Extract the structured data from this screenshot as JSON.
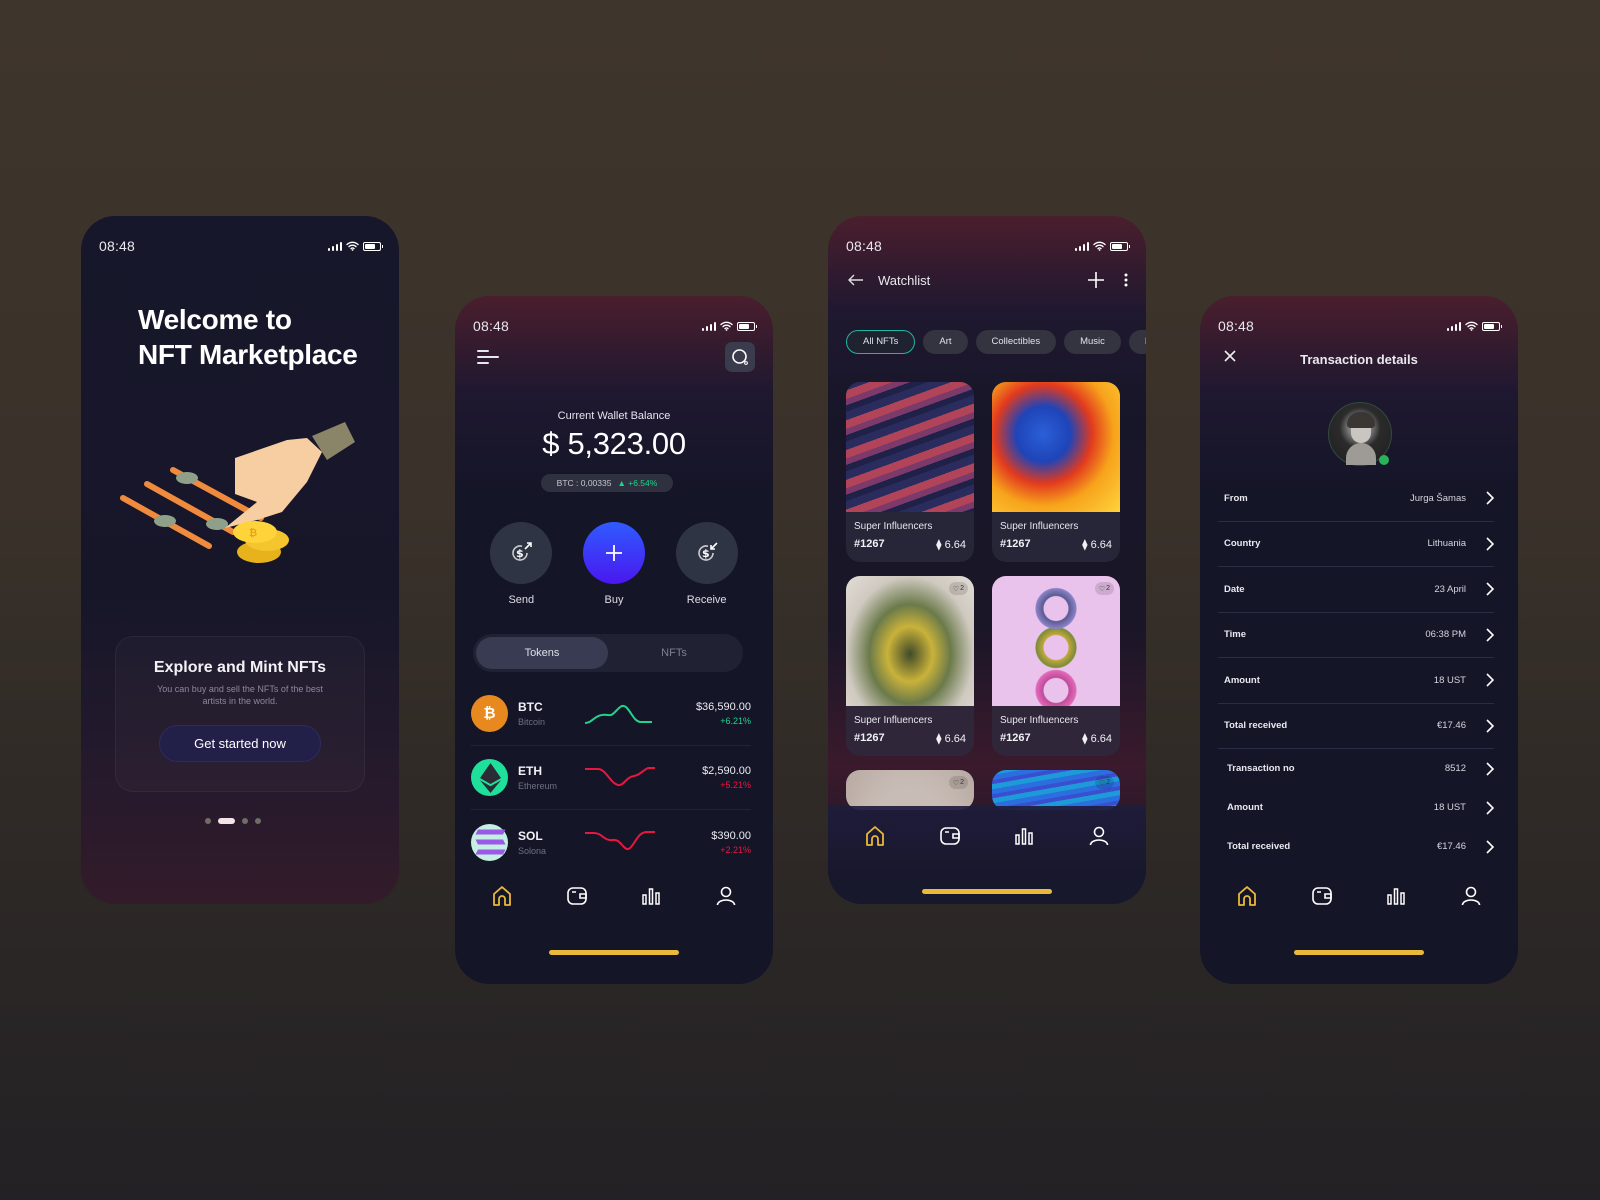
{
  "status_bar": {
    "time": "08:48"
  },
  "onboarding": {
    "title_line1": "Welcome to",
    "title_line2": "NFT Marketplace",
    "card_title": "Explore and Mint NFTs",
    "card_text": "You can buy and sell the NFTs of the best artists in the world.",
    "cta_label": "Get started now",
    "page_index": 2,
    "page_count": 4
  },
  "wallet": {
    "balance_label": "Current Wallet Balance",
    "balance": "$ 5,323.00",
    "btc_label": "BTC : 0,00335",
    "btc_change": "+6.54%",
    "actions": [
      {
        "label": "Send",
        "icon": "send-dollar-icon"
      },
      {
        "label": "Buy",
        "icon": "plus-icon"
      },
      {
        "label": "Receive",
        "icon": "receive-dollar-icon"
      }
    ],
    "tabs": [
      {
        "label": "Tokens",
        "active": true
      },
      {
        "label": "NFTs",
        "active": false
      }
    ],
    "tokens": [
      {
        "symbol": "BTC",
        "name": "Bitcoin",
        "price": "$36,590.00",
        "change": "+6.21%",
        "trend": "up",
        "color": "#e8891f"
      },
      {
        "symbol": "ETH",
        "name": "Ethereum",
        "price": "$2,590.00",
        "change": "+5.21%",
        "trend": "down",
        "color": "#1fe09a"
      },
      {
        "symbol": "SOL",
        "name": "Solona",
        "price": "$390.00",
        "change": "+2.21%",
        "trend": "down",
        "color": "#c4efe3"
      }
    ]
  },
  "watchlist": {
    "title": "Watchlist",
    "chips": [
      {
        "label": "All NFTs",
        "active": true
      },
      {
        "label": "Art",
        "active": false
      },
      {
        "label": "Collectibles",
        "active": false
      },
      {
        "label": "Music",
        "active": false
      },
      {
        "label": "Photo",
        "active": false
      }
    ],
    "items": [
      {
        "collection": "Super Influencers",
        "id": "#1267",
        "price": "6.64",
        "likes": ""
      },
      {
        "collection": "Super Influencers",
        "id": "#1267",
        "price": "6.64",
        "likes": ""
      },
      {
        "collection": "Super Influencers",
        "id": "#1267",
        "price": "6.64",
        "likes": "2"
      },
      {
        "collection": "Super Influencers",
        "id": "#1267",
        "price": "6.64",
        "likes": "2"
      },
      {
        "likes": "2"
      },
      {
        "likes": "2"
      }
    ]
  },
  "transaction": {
    "title": "Transaction details",
    "rows": [
      {
        "label": "From",
        "value": "Jurga Šamas"
      },
      {
        "label": "Country",
        "value": "Lithuania"
      },
      {
        "label": "Date",
        "value": "23 April"
      },
      {
        "label": "Time",
        "value": "06:38 PM"
      },
      {
        "label": "Amount",
        "value": "18 UST"
      },
      {
        "label": "Total received",
        "value": "€17.46"
      },
      {
        "label": "Transaction no",
        "value": "8512"
      },
      {
        "label": "Amount",
        "value": "18 UST"
      },
      {
        "label": "Total received",
        "value": "€17.46"
      }
    ]
  },
  "bottom_nav": [
    {
      "name": "home",
      "active": true
    },
    {
      "name": "wallet",
      "active": false
    },
    {
      "name": "stats",
      "active": false
    },
    {
      "name": "profile",
      "active": false
    }
  ],
  "colors": {
    "accent": "#e8b93b",
    "positive": "#20d38b",
    "negative": "#e8173f",
    "buy": "#3b3cf5",
    "chip_active": "#1eb5a2"
  }
}
